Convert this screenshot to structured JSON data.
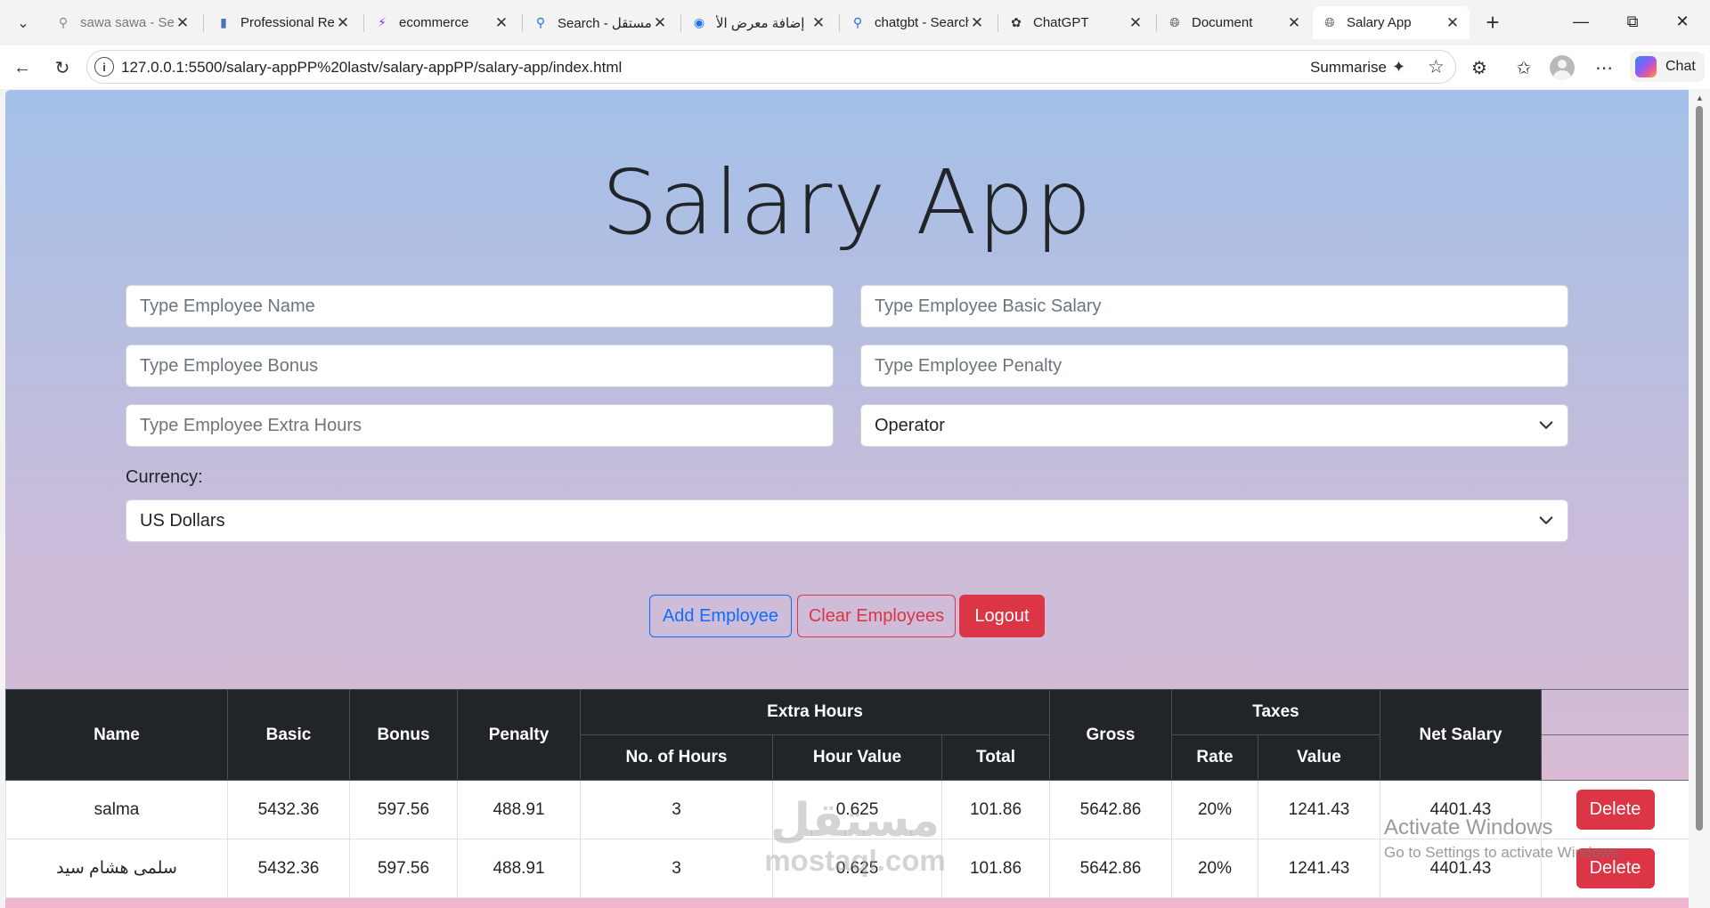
{
  "browser": {
    "tabs": [
      {
        "title": "sawa sawa - Sea",
        "icon": "search-icon",
        "faded": true
      },
      {
        "title": "Professional Rea",
        "icon": "document-icon",
        "faded": false
      },
      {
        "title": "ecommerce",
        "icon": "bolt-icon",
        "faded": false
      },
      {
        "title": "Search - مستقل",
        "icon": "search-icon",
        "faded": false
      },
      {
        "title": "إضافة معرض الأ",
        "icon": "circle-icon",
        "faded": false
      },
      {
        "title": "chatgbt - Search",
        "icon": "search-icon",
        "faded": false
      },
      {
        "title": "ChatGPT",
        "icon": "openai-icon",
        "faded": false
      },
      {
        "title": "Document",
        "icon": "globe-icon",
        "faded": false
      },
      {
        "title": "Salary App",
        "icon": "globe-icon",
        "faded": false,
        "active": true
      }
    ],
    "url": "127.0.0.1:5500/salary-appPP%20lastv/salary-appPP/salary-app/index.html",
    "summarise_label": "Summarise",
    "chat_label": "Chat"
  },
  "page": {
    "title": "Salary App",
    "inputs": {
      "name_placeholder": "Type Employee Name",
      "basic_placeholder": "Type Employee Basic Salary",
      "bonus_placeholder": "Type Employee Bonus",
      "penalty_placeholder": "Type Employee Penalty",
      "extra_hours_placeholder": "Type Employee Extra Hours",
      "operator_value": "Operator"
    },
    "currency_label": "Currency:",
    "currency_value": "US Dollars",
    "buttons": {
      "add": "Add Employee",
      "clear": "Clear Employees",
      "logout": "Logout"
    }
  },
  "table": {
    "headers": {
      "name": "Name",
      "basic": "Basic",
      "bonus": "Bonus",
      "penalty": "Penalty",
      "extra_hours": "Extra Hours",
      "hours": "No. of Hours",
      "hour_value": "Hour Value",
      "total": "Total",
      "gross": "Gross",
      "taxes": "Taxes",
      "rate": "Rate",
      "value": "Value",
      "net": "Net Salary"
    },
    "rows": [
      {
        "name": "salma",
        "basic": "5432.36",
        "bonus": "597.56",
        "penalty": "488.91",
        "hours": "3",
        "hour_value": "0.625",
        "total": "101.86",
        "gross": "5642.86",
        "rate": "20%",
        "value": "1241.43",
        "net": "4401.43",
        "action": "Delete"
      },
      {
        "name": "سلمى هشام سيد",
        "basic": "5432.36",
        "bonus": "597.56",
        "penalty": "488.91",
        "hours": "3",
        "hour_value": "0.625",
        "total": "101.86",
        "gross": "5642.86",
        "rate": "20%",
        "value": "1241.43",
        "net": "4401.43",
        "action": "Delete"
      }
    ]
  },
  "overlays": {
    "watermark_ar": "مستقل",
    "watermark_lat": "mostaql.com",
    "activate_title": "Activate Windows",
    "activate_sub": "Go to Settings to activate Windows."
  }
}
